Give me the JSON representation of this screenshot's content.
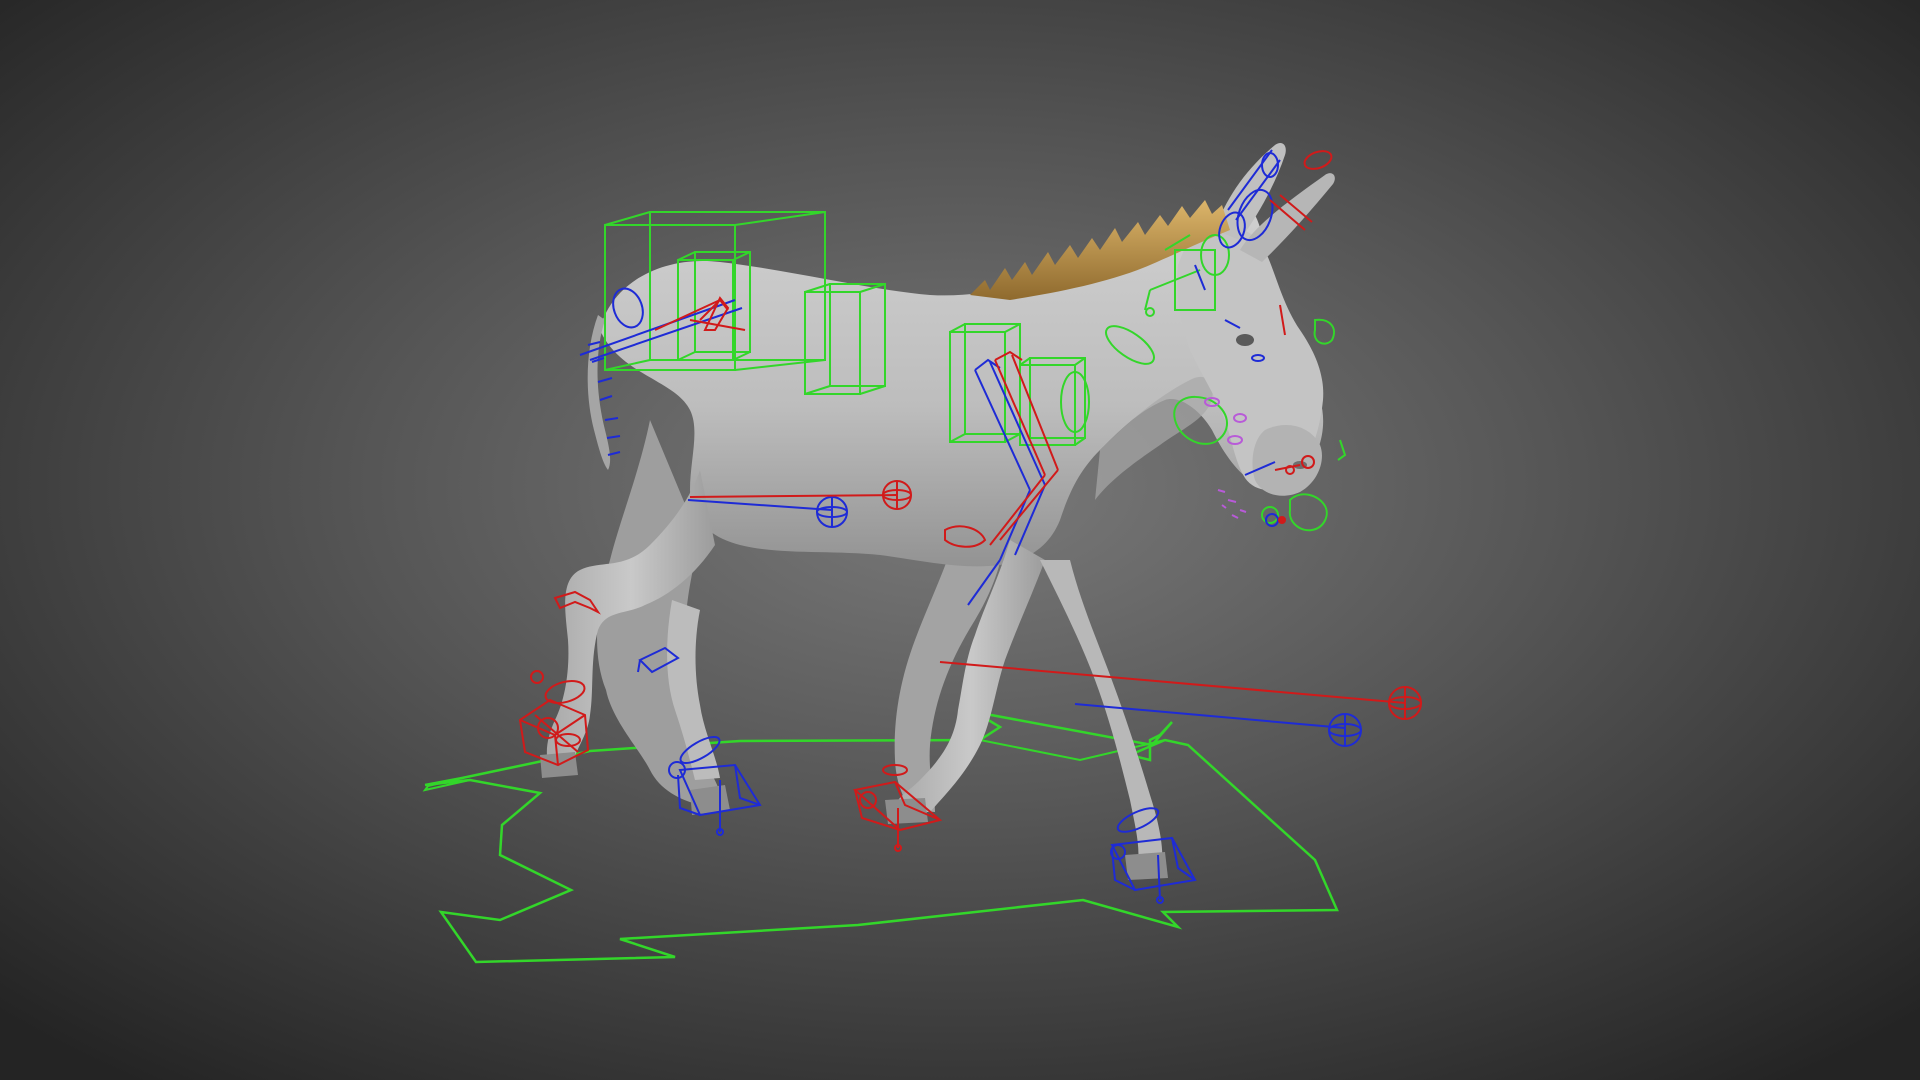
{
  "viewport": {
    "background_center": "#7a7a7a",
    "background_mid": "#555555",
    "background_edge": "#242424",
    "model_color": "#bdbdbd",
    "model_shade": "#8e8e8e",
    "mane_color": "#c9a25a",
    "mane_dark": "#8f6a2e"
  },
  "rig": {
    "left_side_color": "#1e2bd6",
    "right_side_color": "#d11a1a",
    "center_color": "#33d62a",
    "extra_color": "#b85ad8"
  },
  "controls": [
    "root-ground-control",
    "hip-box-control",
    "spine-box-control",
    "chest-box-control",
    "shoulder-box-control",
    "neck-control",
    "head-control",
    "ear-left-control",
    "ear-right-control",
    "jaw-control",
    "tail-control",
    "front-left-hoof-ik",
    "front-right-hoof-ik",
    "rear-left-hoof-ik",
    "rear-right-hoof-ik",
    "knee-pole-left",
    "knee-pole-right",
    "elbow-pole-left",
    "elbow-pole-right"
  ]
}
